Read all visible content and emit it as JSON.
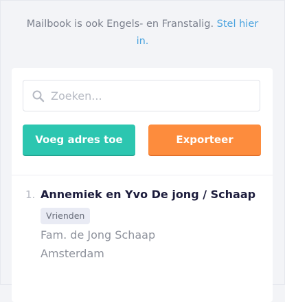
{
  "notice": {
    "text": "Mailbook is ook Engels- en Franstalig.",
    "link_part1": "Stel hier",
    "link_part2": "in."
  },
  "search": {
    "placeholder": "Zoeken...",
    "icon": "search-icon"
  },
  "buttons": {
    "add_label": "Voeg adres toe",
    "export_label": "Exporteer",
    "add_color": "#2cc6b0",
    "export_color": "#fd8c3d"
  },
  "entries": [
    {
      "number": "1.",
      "name": "Annemiek en Yvo De jong / Schaap",
      "tag": "Vrienden",
      "line1": "Fam. de Jong Schaap",
      "line2": "Amsterdam"
    }
  ]
}
